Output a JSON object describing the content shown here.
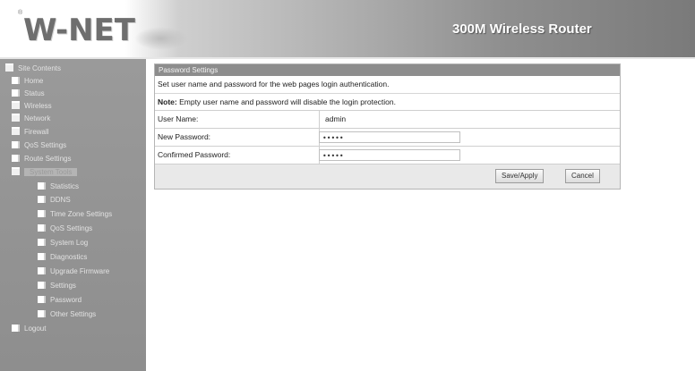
{
  "header": {
    "logo_mark": "®",
    "logo": "W-NET",
    "product": "300M Wireless Router"
  },
  "sidebar": {
    "items": [
      {
        "label": "Site Contents",
        "icon": "folder-open-icon"
      },
      {
        "label": "Home",
        "icon": "page-icon"
      },
      {
        "label": "Status",
        "icon": "page-icon"
      },
      {
        "label": "Wireless",
        "icon": "folder-icon"
      },
      {
        "label": "Network",
        "icon": "folder-icon"
      },
      {
        "label": "Firewall",
        "icon": "folder-icon"
      },
      {
        "label": "QoS Settings",
        "icon": "page-icon"
      },
      {
        "label": "Route Settings",
        "icon": "page-icon"
      },
      {
        "label": "System Tools",
        "icon": "folder-open-icon"
      },
      {
        "label": "Statistics",
        "icon": "page-icon"
      },
      {
        "label": "DDNS",
        "icon": "page-icon"
      },
      {
        "label": "Time Zone Settings",
        "icon": "page-icon"
      },
      {
        "label": "QoS Settings",
        "icon": "page-icon"
      },
      {
        "label": "System Log",
        "icon": "page-icon"
      },
      {
        "label": "Diagnostics",
        "icon": "page-icon"
      },
      {
        "label": "Upgrade Firmware",
        "icon": "page-icon"
      },
      {
        "label": "Settings",
        "icon": "page-icon"
      },
      {
        "label": "Password",
        "icon": "page-icon"
      },
      {
        "label": "Other Settings",
        "icon": "page-icon"
      },
      {
        "label": "Logout",
        "icon": "page-icon"
      }
    ]
  },
  "panel": {
    "title": "Password Settings",
    "description": "Set user name and password for the web pages login authentication.",
    "note_label": "Note:",
    "note_text": " Empty user name and password will disable the login protection.",
    "fields": {
      "username_label": "User Name:",
      "username_value": "admin",
      "new_password_label": "New Password:",
      "new_password_value": "•••••",
      "confirm_password_label": "Confirmed Password:",
      "confirm_password_value": "•••••"
    },
    "buttons": {
      "save": "Save/Apply",
      "cancel": "Cancel"
    }
  },
  "colors": {
    "sidebar_bg": "#9a9a9a",
    "panel_title_bg": "#8d8d8d",
    "button_row_bg": "#e9e9e9"
  }
}
